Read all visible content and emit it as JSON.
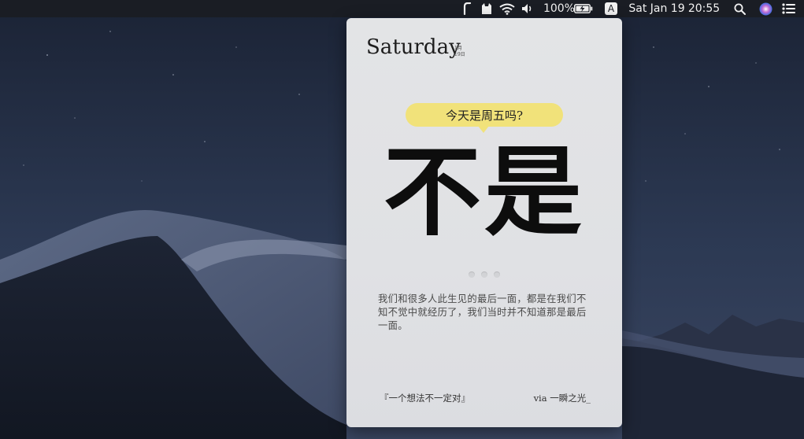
{
  "menubar": {
    "battery_percent": "100%",
    "input_source": "A",
    "date": "Sat Jan 19",
    "time": "20:55",
    "icons": [
      "tune-icon",
      "cat-icon",
      "wifi-icon",
      "volume-icon",
      "battery-charging-icon",
      "input-source-icon",
      "spotlight-search-icon",
      "siri-icon",
      "notification-center-icon"
    ]
  },
  "widget": {
    "day_name": "Saturday",
    "date_month": "1月",
    "date_day": "19日",
    "question": "今天是周五吗?",
    "answer": "不是",
    "quote": "我们和很多人此生见的最后一面，都是在我们不知不觉中就经历了，我们当时并不知道那是最后一面。",
    "source": "『一个想法不一定对』",
    "via": "via 一瞬之光_",
    "bubble_color": "#f1e27a"
  }
}
